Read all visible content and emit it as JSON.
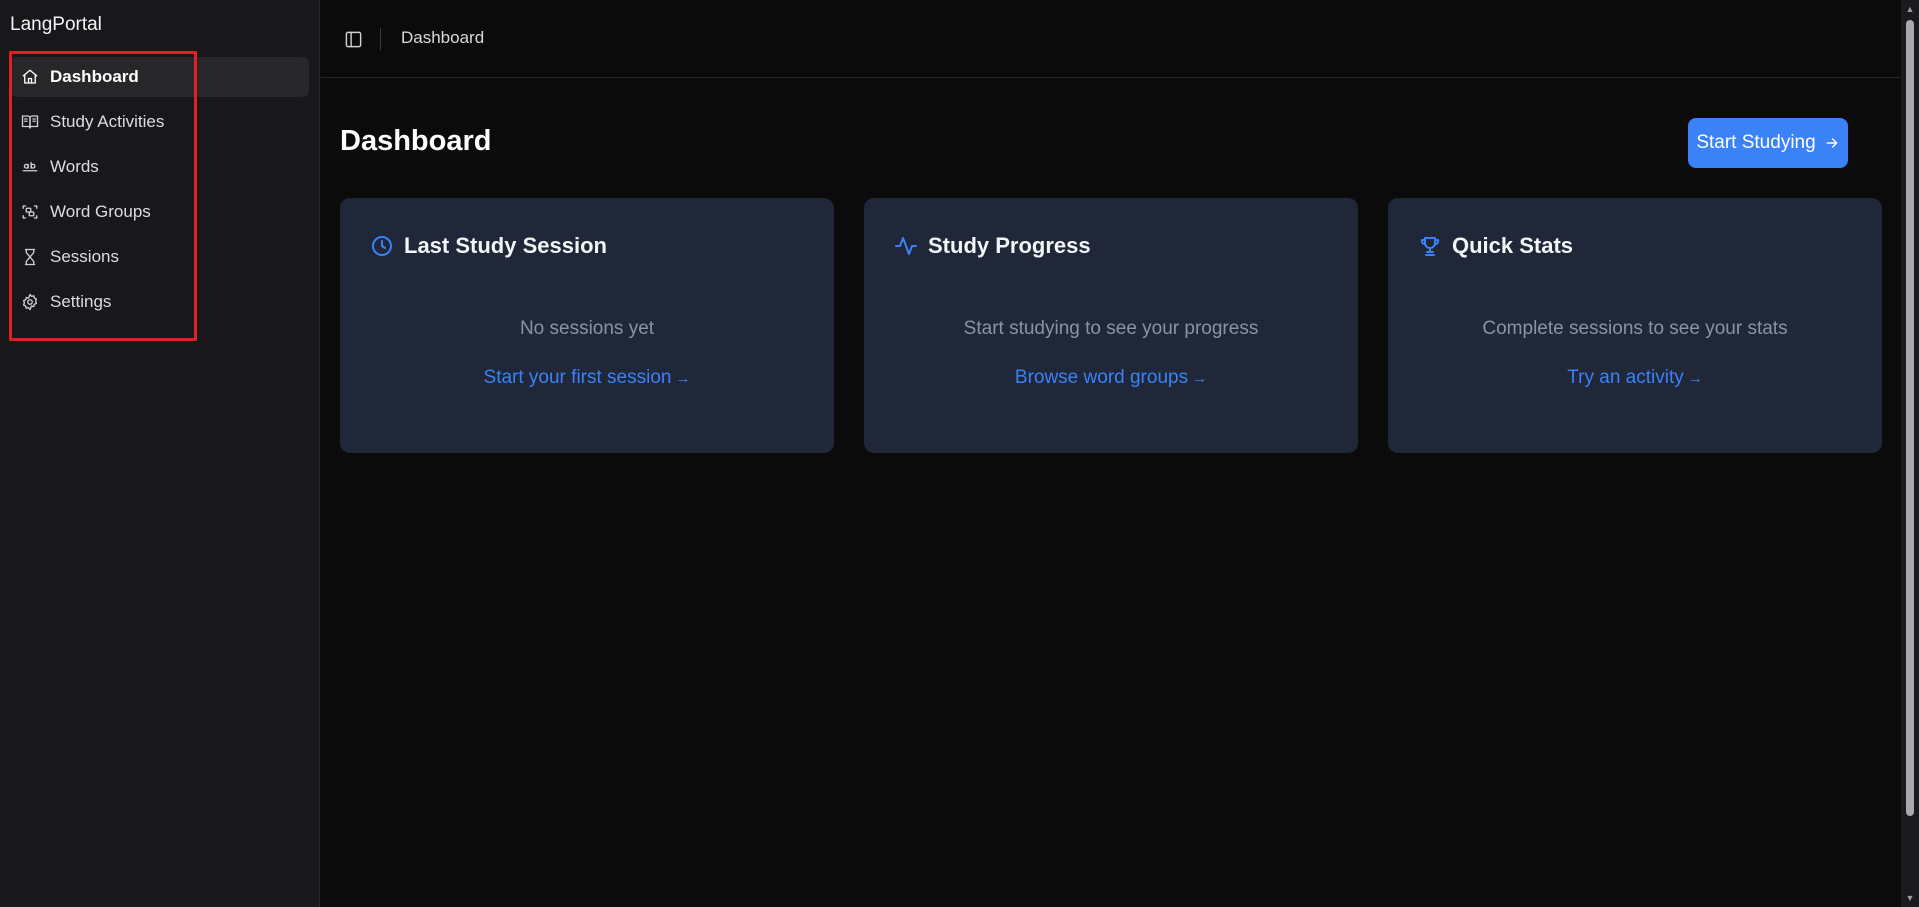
{
  "brand": "LangPortal",
  "sidebar": {
    "items": [
      {
        "label": "Dashboard",
        "icon": "home-icon"
      },
      {
        "label": "Study Activities",
        "icon": "book-open-icon"
      },
      {
        "label": "Words",
        "icon": "whole-word-icon"
      },
      {
        "label": "Word Groups",
        "icon": "group-icon"
      },
      {
        "label": "Sessions",
        "icon": "hourglass-icon"
      },
      {
        "label": "Settings",
        "icon": "gear-icon"
      }
    ]
  },
  "topbar": {
    "breadcrumb": "Dashboard",
    "toggle_icon": "panel-left-icon"
  },
  "main": {
    "title": "Dashboard",
    "start_button": "Start Studying",
    "cards": [
      {
        "title": "Last Study Session",
        "icon": "clock-icon",
        "message": "No sessions yet",
        "link": "Start your first session"
      },
      {
        "title": "Study Progress",
        "icon": "activity-icon",
        "message": "Start studying to see your progress",
        "link": "Browse word groups"
      },
      {
        "title": "Quick Stats",
        "icon": "trophy-icon",
        "message": "Complete sessions to see your stats",
        "link": "Try an activity"
      }
    ]
  },
  "colors": {
    "accent": "#3b82f6",
    "card_bg": "#1f2738",
    "highlight": "#e01f26"
  },
  "arrow": "→"
}
